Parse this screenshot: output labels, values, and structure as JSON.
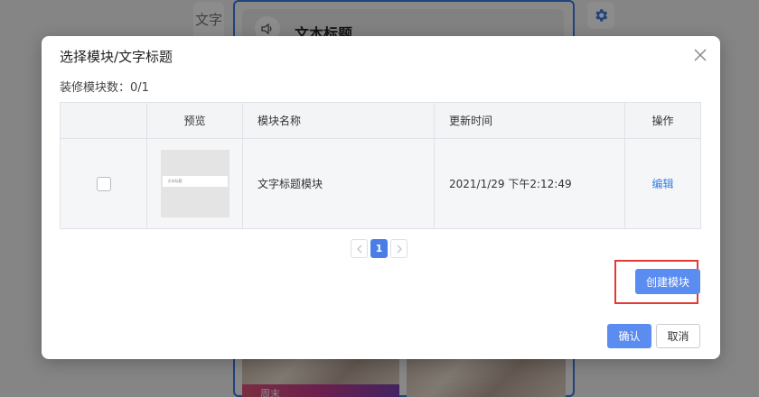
{
  "background": {
    "side_tab_label": "文字",
    "widget_title": "文本标题",
    "banner_text": "周末"
  },
  "dialog": {
    "title": "选择模块/文字标题",
    "module_count_label": "装修模块数：0/1",
    "table": {
      "headers": [
        "",
        "预览",
        "模块名称",
        "更新时间",
        "操作"
      ],
      "rows": [
        {
          "checked": false,
          "preview_text": "文本标题",
          "name": "文字标题模块",
          "updated": "2021/1/29 下午2:12:49",
          "action": "编辑"
        }
      ]
    },
    "pagination": {
      "prev": "<",
      "current": "1",
      "next": ">"
    },
    "create_button": "创建模块",
    "confirm_button": "确认",
    "cancel_button": "取消"
  },
  "colors": {
    "primary": "#5b8cf0",
    "link": "#3b7ddd",
    "highlight": "#e53935"
  }
}
